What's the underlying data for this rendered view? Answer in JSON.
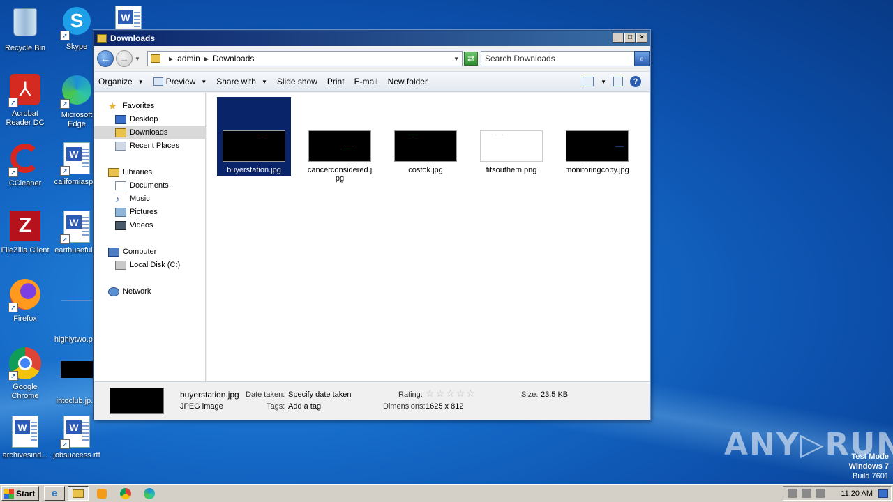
{
  "desktop": {
    "icons": [
      {
        "label": "Recycle Bin",
        "icon": "recycle-bin-icon"
      },
      {
        "label": "Skype",
        "icon": "skype-icon"
      },
      {
        "label": "Acrobat Reader DC",
        "icon": "acrobat-icon"
      },
      {
        "label": "Microsoft Edge",
        "icon": "edge-icon"
      },
      {
        "label": "CCleaner",
        "icon": "ccleaner-icon"
      },
      {
        "label": "californiasp...",
        "icon": "word-doc-icon"
      },
      {
        "label": "FileZilla Client",
        "icon": "filezilla-icon"
      },
      {
        "label": "earthuseful...",
        "icon": "word-doc-icon"
      },
      {
        "label": "Firefox",
        "icon": "firefox-icon"
      },
      {
        "label": "highlytwo.p...",
        "icon": "image-file-icon"
      },
      {
        "label": "Google Chrome",
        "icon": "chrome-icon"
      },
      {
        "label": "intoclub.jp...",
        "icon": "image-file-icon"
      },
      {
        "label": "archivesind...",
        "icon": "word-doc-icon"
      },
      {
        "label": "jobsuccess.rtf",
        "icon": "word-doc-icon"
      }
    ]
  },
  "window": {
    "title": "Downloads",
    "breadcrumb": [
      "admin",
      "Downloads"
    ],
    "search_placeholder": "Search Downloads",
    "toolbar": {
      "organize": "Organize",
      "preview": "Preview",
      "share_with": "Share with",
      "slide_show": "Slide show",
      "print": "Print",
      "email": "E-mail",
      "new_folder": "New folder"
    },
    "nav": {
      "favorites": "Favorites",
      "desktop": "Desktop",
      "downloads": "Downloads",
      "recent_places": "Recent Places",
      "libraries": "Libraries",
      "documents": "Documents",
      "music": "Music",
      "pictures": "Pictures",
      "videos": "Videos",
      "computer": "Computer",
      "local_disk": "Local Disk (C:)",
      "network": "Network"
    },
    "files": [
      {
        "name": "buyerstation.jpg",
        "thumb": "dark",
        "selected": true
      },
      {
        "name": "cancerconsidered.jpg",
        "thumb": "dark",
        "selected": false
      },
      {
        "name": "costok.jpg",
        "thumb": "dark",
        "selected": false
      },
      {
        "name": "fitsouthern.png",
        "thumb": "white",
        "selected": false
      },
      {
        "name": "monitoringcopy.jpg",
        "thumb": "dark",
        "selected": false
      }
    ],
    "details": {
      "filename": "buyerstation.jpg",
      "filetype": "JPEG image",
      "date_taken_label": "Date taken:",
      "date_taken_value": "Specify date taken",
      "tags_label": "Tags:",
      "tags_value": "Add a tag",
      "rating_label": "Rating:",
      "rating_stars": 0,
      "dimensions_label": "Dimensions:",
      "dimensions_value": "1625 x 812",
      "size_label": "Size:",
      "size_value": "23.5 KB"
    }
  },
  "taskbar": {
    "start_label": "Start",
    "clock": "11:20 AM"
  },
  "watermark": {
    "brand": "ANY▷RUN",
    "test_mode": "Test Mode",
    "os": "Windows 7",
    "build": "Build 7601"
  },
  "colors": {
    "selection": "#0a246a",
    "desktop_blue": "#1569c7"
  }
}
